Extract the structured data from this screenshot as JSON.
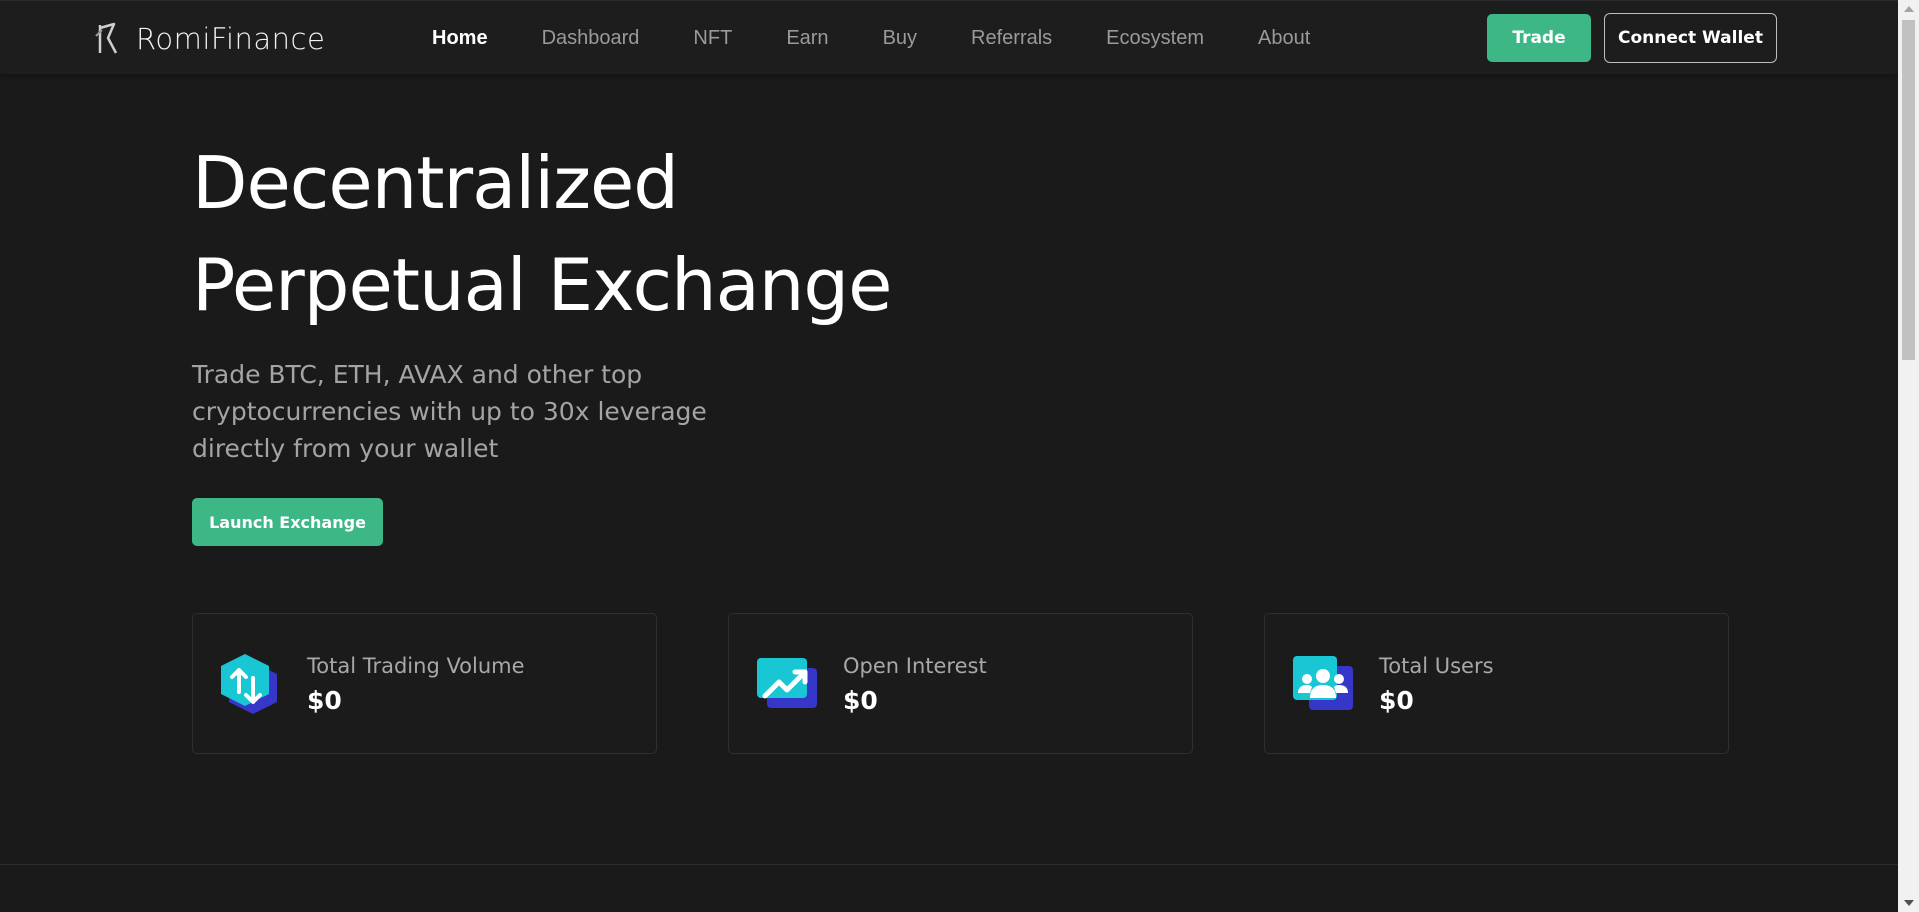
{
  "brand": {
    "name": "RomiFinance"
  },
  "nav": {
    "items": [
      {
        "label": "Home",
        "active": true
      },
      {
        "label": "Dashboard"
      },
      {
        "label": "NFT"
      },
      {
        "label": "Earn"
      },
      {
        "label": "Buy"
      },
      {
        "label": "Referrals"
      },
      {
        "label": "Ecosystem"
      },
      {
        "label": "About"
      }
    ]
  },
  "header": {
    "trade_label": "Trade",
    "connect_label": "Connect Wallet"
  },
  "hero": {
    "title_line1": "Decentralized",
    "title_line2": "Perpetual Exchange",
    "subtitle_line1": "Trade BTC, ETH, AVAX and other top",
    "subtitle_line2": "cryptocurrencies with up to 30x leverage",
    "subtitle_line3": "directly from your wallet",
    "cta_label": "Launch Exchange"
  },
  "stats": [
    {
      "label": "Total Trading Volume",
      "value": "$0",
      "icon": "trading-volume-icon"
    },
    {
      "label": "Open Interest",
      "value": "$0",
      "icon": "open-interest-icon"
    },
    {
      "label": "Total Users",
      "value": "$0",
      "icon": "users-icon"
    }
  ],
  "colors": {
    "background": "#1a1a1a",
    "accent": "#3db786",
    "icon_cyan": "#19c6d4",
    "icon_indigo": "#3636c9"
  }
}
